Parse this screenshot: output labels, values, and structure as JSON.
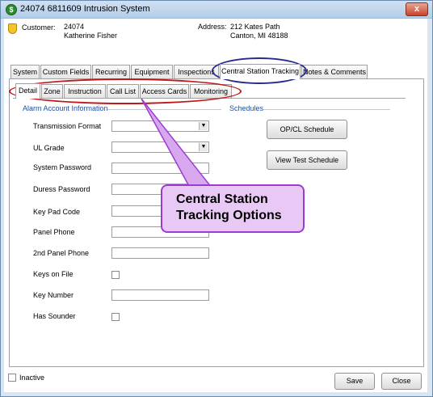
{
  "window": {
    "title": "24074 6811609 Intrusion System",
    "close_glyph": "x"
  },
  "customer": {
    "label": "Customer:",
    "number": "24074",
    "name": "Katherine Fisher"
  },
  "address": {
    "label": "Address:",
    "line1": "212  Kates Path",
    "line2": "Canton, MI  48188"
  },
  "main_tabs": [
    "System",
    "Custom Fields",
    "Recurring",
    "Equipment",
    "Inspections",
    "Central Station Tracking",
    "Notes & Comments"
  ],
  "sub_tabs": [
    "Detail",
    "Zone",
    "Instruction",
    "Call List",
    "Access Cards",
    "Monitoring"
  ],
  "alarm_group": {
    "title": "Alarm Account Information",
    "fields": {
      "transmission_format": "Transmission Format",
      "ul_grade": "UL Grade",
      "system_password": "System Password",
      "duress_password": "Duress Password",
      "key_pad_code": "Key Pad Code",
      "panel_phone": "Panel Phone",
      "second_panel_phone": "2nd Panel Phone",
      "keys_on_file": "Keys on File",
      "key_number": "Key Number",
      "has_sounder": "Has Sounder"
    }
  },
  "schedules_group": {
    "title": "Schedules",
    "opcl_button": "OP/CL Schedule",
    "test_button": "View Test Schedule"
  },
  "footer": {
    "inactive_label": "Inactive",
    "save_button": "Save",
    "close_button": "Close"
  },
  "callout": {
    "line1": "Central Station",
    "line2": "Tracking Options"
  },
  "colors": {
    "callout_fill": "#e8c8f4",
    "callout_border": "#9d3bd1",
    "ellipse_main_tab": "#2a2a8a",
    "ellipse_sub_tabs": "#c01818"
  }
}
